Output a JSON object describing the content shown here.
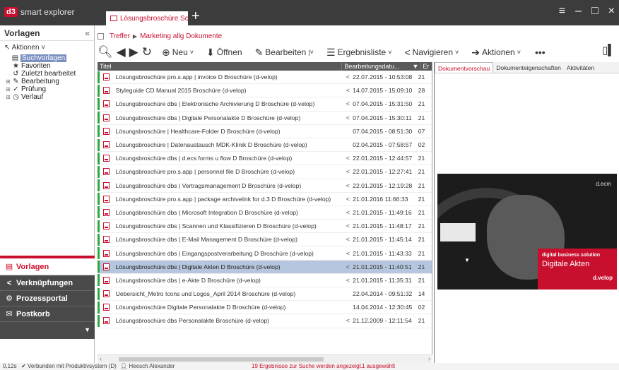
{
  "app": {
    "logo": "d3",
    "name": "smart explorer",
    "tab_label": "Lösungsbroschüre Schablone",
    "add_tab": "+",
    "menu_icon": "hamburger-icon",
    "window_controls": [
      "≡",
      "–",
      "□",
      "×"
    ]
  },
  "sidebar": {
    "title": "Vorlagen",
    "collapse": "«",
    "actions_label": "Aktionen ˅",
    "tree": [
      {
        "label": "Suchvorlagen",
        "icon": "search-template-icon",
        "selected": true,
        "sub": true
      },
      {
        "label": "Favoriten",
        "icon": "star-icon"
      },
      {
        "label": "Zuletzt bearbeitet",
        "icon": "history-icon"
      },
      {
        "label": "Bearbeitung",
        "icon": "edit-circle-icon",
        "expandable": true
      },
      {
        "label": "Prüfung",
        "icon": "check-circle-icon",
        "expandable": true
      },
      {
        "label": "Verlauf",
        "icon": "clock-icon",
        "expandable": true
      }
    ],
    "nav": [
      {
        "label": "Vorlagen",
        "icon": "template-icon",
        "active": true
      },
      {
        "label": "Verknüpfungen",
        "icon": "share-icon"
      },
      {
        "label": "Prozessportal",
        "icon": "process-icon"
      },
      {
        "label": "Postkorb",
        "icon": "mail-icon"
      }
    ]
  },
  "breadcrumb": {
    "items": [
      "Treffer",
      "Marketing allg Dokumente"
    ],
    "separator": "▶"
  },
  "toolbar": {
    "new_label": "Neu",
    "open_label": "Öffnen",
    "edit_label": "Bearbeiten",
    "resultlist_label": "Ergebnisliste",
    "navigate_label": "Navigieren",
    "actions_label": "Aktionen",
    "more": "•••"
  },
  "grid": {
    "columns": {
      "title": "Titel",
      "date": "Bearbeitungsdatu...",
      "sort": "▼",
      "extra": "Er"
    },
    "rows": [
      {
        "title": "Lösungsbroschüre pro.s.app | invoice D Broschüre (d-velop)",
        "date": "22.07.2015 - 10:53:08",
        "extra": "21",
        "shared": true
      },
      {
        "title": "Styleguide CD Manual 2015 Broschüre (d-velop)",
        "date": "14.07.2015 - 15:09:10",
        "extra": "28",
        "shared": true
      },
      {
        "title": "Lösungsbroschüre dbs | Elektronische Archivierung D Broschüre (d-velop)",
        "date": "07.04.2015 - 15:31:50",
        "extra": "21",
        "shared": true
      },
      {
        "title": "Lösungsbroschüre dbs | Digitale Personalakte D Broschüre (d-velop)",
        "date": "07.04.2015 - 15:30:11",
        "extra": "21",
        "shared": true
      },
      {
        "title": "Lösungsbroschüre | Healthcare-Folder D Broschüre (d-velop)",
        "date": "07.04.2015 - 08:51:30",
        "extra": "07",
        "shared": false
      },
      {
        "title": "Lösungsbroschüre | Datenaustausch MDK-Klinik D Broschüre (d-velop)",
        "date": "02.04.2015 - 07:58:57",
        "extra": "02",
        "shared": false
      },
      {
        "title": "Lösungsbroschüre dbs | d.ecs forms u flow D Broschüre (d-velop)",
        "date": "22.01.2015 - 12:44:57",
        "extra": "21",
        "shared": true
      },
      {
        "title": "Lösungsbroschüre pro.s.app | personnel file D Broschüre (d-velop)",
        "date": "22.01.2015 - 12:27:41",
        "extra": "21",
        "shared": true
      },
      {
        "title": "Lösungsbroschüre dbs | Vertragsmanagement D Broschüre (d-velop)",
        "date": "22.01.2015 - 12:19:28",
        "extra": "21",
        "shared": true
      },
      {
        "title": "Lösungsbroschüre pro.s.app | package archivelink for d.3 D Broschüre (d-velop)",
        "date": "21.01.2016  11:66:33",
        "extra": "21",
        "shared": true
      },
      {
        "title": "Lösungsbroschüre dbs | Microsoft Integration D Broschüre (d-velop)",
        "date": "21.01.2015 - 11:49:16",
        "extra": "21",
        "shared": true
      },
      {
        "title": "Lösungsbroschüre dbs | Scannen und Klassifizieren D Broschüre (d-velop)",
        "date": "21.01.2015 - 11:48:17",
        "extra": "21",
        "shared": true
      },
      {
        "title": "Lösungsbroschüre dbs | E-Mail Management D Broschüre (d-velop)",
        "date": "21.01.2015 - 11:45:14",
        "extra": "21",
        "shared": true
      },
      {
        "title": "Lösungsbroschüre dbs | Eingangspostverarbeitung D Broschüre (d-velop)",
        "date": "21.01.2015 - 11:43:33",
        "extra": "21",
        "shared": true
      },
      {
        "title": "Lösungsbroschüre dbs | Digitale Akten D Broschüre (d-velop)",
        "date": "21.01.2015 - 11:40:51",
        "extra": "21",
        "shared": true,
        "selected": true
      },
      {
        "title": "Lösungsbroschüre dbs | e-Akte D Broschüre (d-velop)",
        "date": "21.01.2015 - 11:35:31",
        "extra": "21",
        "shared": true
      },
      {
        "title": "Uebersicht_Metro Icons und Logos_April 2014 Broschüre (d-velop)",
        "date": "22.04.2014 - 09:51:32",
        "extra": "14",
        "shared": false
      },
      {
        "title": "Lösungsbroschüre Digitale Personalakte D Broschüre (d-velop)",
        "date": "14.04.2014 - 12:30:45",
        "extra": "02",
        "shared": false
      },
      {
        "title": "Lösungsbroschüre dbs Personalakte Broschüre (d-velop)",
        "date": "21.12.2009 - 12:11:54",
        "extra": "21",
        "shared": true
      }
    ]
  },
  "preview": {
    "tabs": [
      "Dokumentvorschau",
      "Dokumenteigenschaften",
      "Aktivitäten"
    ],
    "brand_top": "d.ecm",
    "band_line1": "digital business solution",
    "band_line2": "Digitale Akten",
    "band_line3": "d.velop",
    "marker": "▼"
  },
  "status": {
    "time": "0,12s",
    "connection": "Verbunden mit Produktivsystem (D)",
    "user": "Heesch Alexander",
    "results": "19 Ergebnisse zur Suche werden angezeigt.",
    "selected": "1 ausgewählt"
  }
}
